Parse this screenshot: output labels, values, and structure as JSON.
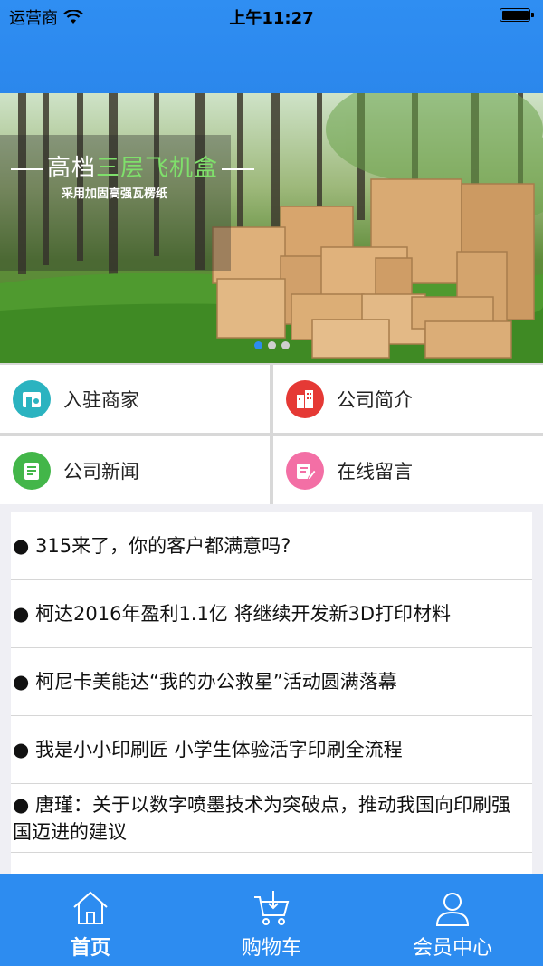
{
  "status_bar": {
    "carrier": "运营商",
    "time": "上午11:27"
  },
  "banner": {
    "title_prefix": "高档",
    "title_accent": "三层飞机盒",
    "subtitle": "采用加固高强瓦楞纸",
    "page_count": 3,
    "active_page": 1
  },
  "menu": {
    "items": [
      {
        "label": "入驻商家",
        "icon": "store-icon",
        "color": "#2bb3c0"
      },
      {
        "label": "公司简介",
        "icon": "building-icon",
        "color": "#e53935"
      },
      {
        "label": "公司新闻",
        "icon": "news-icon",
        "color": "#43b649"
      },
      {
        "label": "在线留言",
        "icon": "message-edit-icon",
        "color": "#f36fa5"
      }
    ]
  },
  "news": {
    "items": [
      "● 315来了，你的客户都满意吗?",
      "● 柯达2016年盈利1.1亿 将继续开发新3D打印材料",
      "● 柯尼卡美能达“我的办公救星”活动圆满落幕",
      "● 我是小小印刷匠 小学生体验活字印刷全流程",
      "● 唐瑾：关于以数字喷墨技术为突破点，推动我国向印刷强国迈进的建议"
    ]
  },
  "tabbar": {
    "tabs": [
      {
        "label": "首页",
        "icon": "home-icon",
        "active": true
      },
      {
        "label": "购物车",
        "icon": "cart-icon",
        "active": false
      },
      {
        "label": "会员中心",
        "icon": "user-icon",
        "active": false
      }
    ]
  },
  "colors": {
    "primary": "#2d8cf0",
    "background": "#efeff4"
  }
}
